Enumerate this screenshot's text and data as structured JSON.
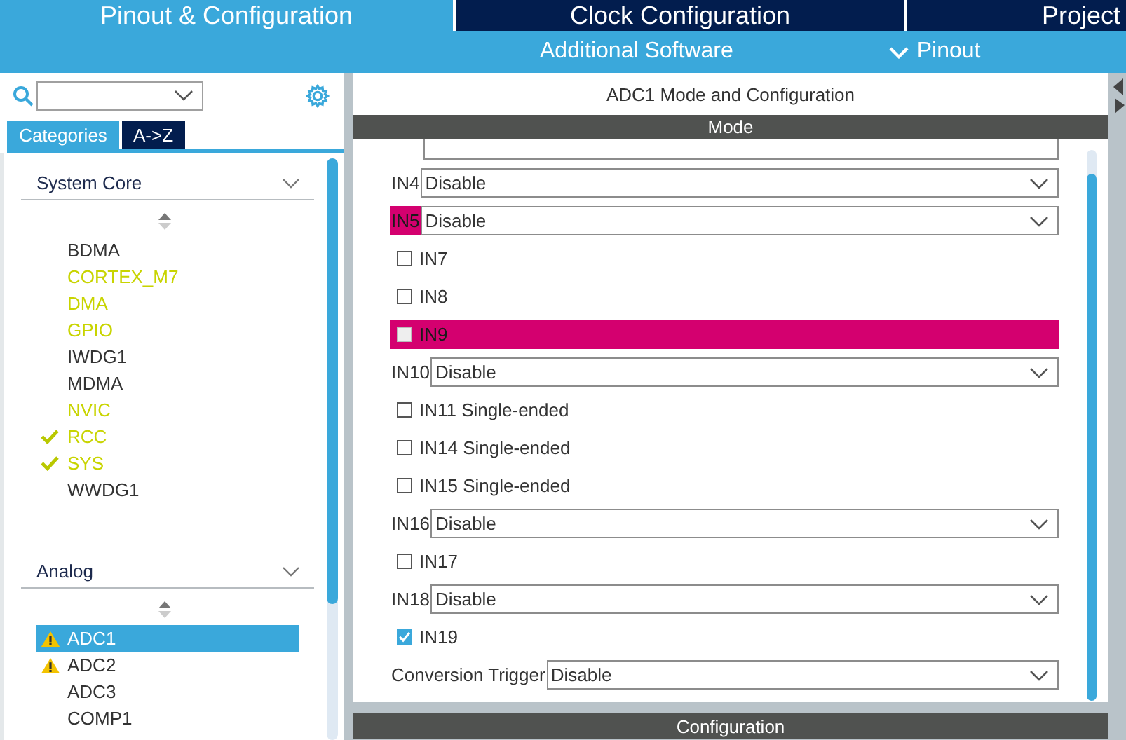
{
  "tabs": [
    {
      "label": "Pinout & Configuration",
      "selected": true
    },
    {
      "label": "Clock Configuration",
      "selected": false
    },
    {
      "label": "Project",
      "selected": false
    }
  ],
  "subbar": {
    "items": [
      {
        "label": "Additional Software",
        "kind": "link"
      },
      {
        "label": "Pinout",
        "kind": "dropdown"
      }
    ]
  },
  "sidebar": {
    "view_tabs": [
      {
        "label": "Categories",
        "selected": true
      },
      {
        "label": "A->Z",
        "selected": false
      }
    ],
    "groups": [
      {
        "title": "System Core",
        "expanded": true,
        "items": [
          {
            "label": "BDMA",
            "configured": false,
            "ok": false,
            "warning": false,
            "selected": false
          },
          {
            "label": "CORTEX_M7",
            "configured": true,
            "ok": false,
            "warning": false,
            "selected": false
          },
          {
            "label": "DMA",
            "configured": true,
            "ok": false,
            "warning": false,
            "selected": false
          },
          {
            "label": "GPIO",
            "configured": true,
            "ok": false,
            "warning": false,
            "selected": false
          },
          {
            "label": "IWDG1",
            "configured": false,
            "ok": false,
            "warning": false,
            "selected": false
          },
          {
            "label": "MDMA",
            "configured": false,
            "ok": false,
            "warning": false,
            "selected": false
          },
          {
            "label": "NVIC",
            "configured": true,
            "ok": false,
            "warning": false,
            "selected": false
          },
          {
            "label": "RCC",
            "configured": true,
            "ok": true,
            "warning": false,
            "selected": false
          },
          {
            "label": "SYS",
            "configured": true,
            "ok": true,
            "warning": false,
            "selected": false
          },
          {
            "label": "WWDG1",
            "configured": false,
            "ok": false,
            "warning": false,
            "selected": false
          }
        ]
      },
      {
        "title": "Analog",
        "expanded": true,
        "items": [
          {
            "label": "ADC1",
            "configured": false,
            "ok": false,
            "warning": true,
            "selected": true
          },
          {
            "label": "ADC2",
            "configured": false,
            "ok": false,
            "warning": true,
            "selected": false
          },
          {
            "label": "ADC3",
            "configured": false,
            "ok": false,
            "warning": false,
            "selected": false
          },
          {
            "label": "COMP1",
            "configured": false,
            "ok": false,
            "warning": false,
            "selected": false
          }
        ]
      }
    ]
  },
  "panel": {
    "title": "ADC1 Mode and Configuration",
    "mode_header": "Mode",
    "config_header": "Configuration",
    "rows": [
      {
        "kind": "select",
        "label": "IN4",
        "value": "Disable",
        "highlighted": false
      },
      {
        "kind": "select",
        "label": "IN5",
        "value": "Disable",
        "highlighted": true
      },
      {
        "kind": "checkbox",
        "label": "IN7",
        "checked": false,
        "highlighted": false
      },
      {
        "kind": "checkbox",
        "label": "IN8",
        "checked": false,
        "highlighted": false
      },
      {
        "kind": "checkbox",
        "label": "IN9",
        "checked": false,
        "highlighted": true
      },
      {
        "kind": "select",
        "label": "IN10",
        "value": "Disable",
        "highlighted": false
      },
      {
        "kind": "checkbox",
        "label": "IN11 Single-ended",
        "checked": false,
        "highlighted": false
      },
      {
        "kind": "checkbox",
        "label": "IN14 Single-ended",
        "checked": false,
        "highlighted": false
      },
      {
        "kind": "checkbox",
        "label": "IN15 Single-ended",
        "checked": false,
        "highlighted": false
      },
      {
        "kind": "select",
        "label": "IN16",
        "value": "Disable",
        "highlighted": false
      },
      {
        "kind": "checkbox",
        "label": "IN17",
        "checked": false,
        "highlighted": false
      },
      {
        "kind": "select",
        "label": "IN18",
        "value": "Disable",
        "highlighted": false
      },
      {
        "kind": "checkbox",
        "label": "IN19",
        "checked": true,
        "highlighted": false
      },
      {
        "kind": "select",
        "label": "Conversion Trigger",
        "value": "Disable",
        "highlighted": false
      }
    ]
  }
}
